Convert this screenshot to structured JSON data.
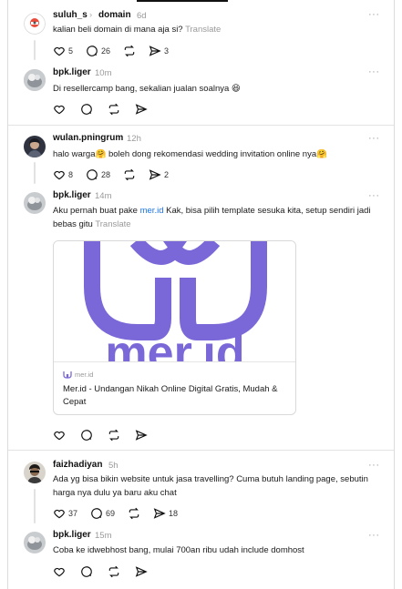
{
  "thread1": {
    "user": "suluh_s",
    "chevron": "›",
    "topic": "domain",
    "time": "6d",
    "more": "···",
    "text": "kalian beli domain di mana aja si?",
    "translate": "Translate",
    "likes": "5",
    "comments": "26",
    "reposts": "",
    "shares": "3"
  },
  "reply1": {
    "user": "bpk.liger",
    "time": "10m",
    "more": "···",
    "text": "Di resellercamp bang, sekalian jualan soalnya 😆"
  },
  "thread2": {
    "user": "wulan.pningrum",
    "time": "12h",
    "more": "···",
    "text": "halo warga🤗 boleh dong rekomendasi wedding invitation online nya🤗",
    "likes": "8",
    "comments": "28",
    "shares": "2"
  },
  "reply2": {
    "user": "bpk.liger",
    "time": "14m",
    "more": "···",
    "text_before": "Aku pernah buat pake ",
    "link": "mer.id",
    "text_after": " Kak, bisa pilih template sesuka kita, setup sendiri jadi bebas gitu ",
    "translate": "Translate",
    "card": {
      "domain": "mer.id",
      "title": "Mer.id - Undangan Nikah Online Digital Gratis, Mudah & Cepat",
      "logo_text": "mer.id",
      "logo_color": "#7b68d8"
    }
  },
  "thread3": {
    "user": "faizhadiyan",
    "time": "5h",
    "more": "···",
    "text": "Ada yg bisa bikin website untuk jasa travelling? Cuma butuh landing page, sebutin harga nya dulu ya baru aku chat",
    "likes": "37",
    "comments": "69",
    "shares": "18"
  },
  "reply3": {
    "user": "bpk.liger",
    "time": "15m",
    "more": "···",
    "text": "Coba ke idwebhost bang, mulai 700an ribu udah include domhost"
  },
  "icons": {
    "like": "heart-icon",
    "comment": "comment-icon",
    "repost": "repost-icon",
    "share": "share-icon"
  }
}
